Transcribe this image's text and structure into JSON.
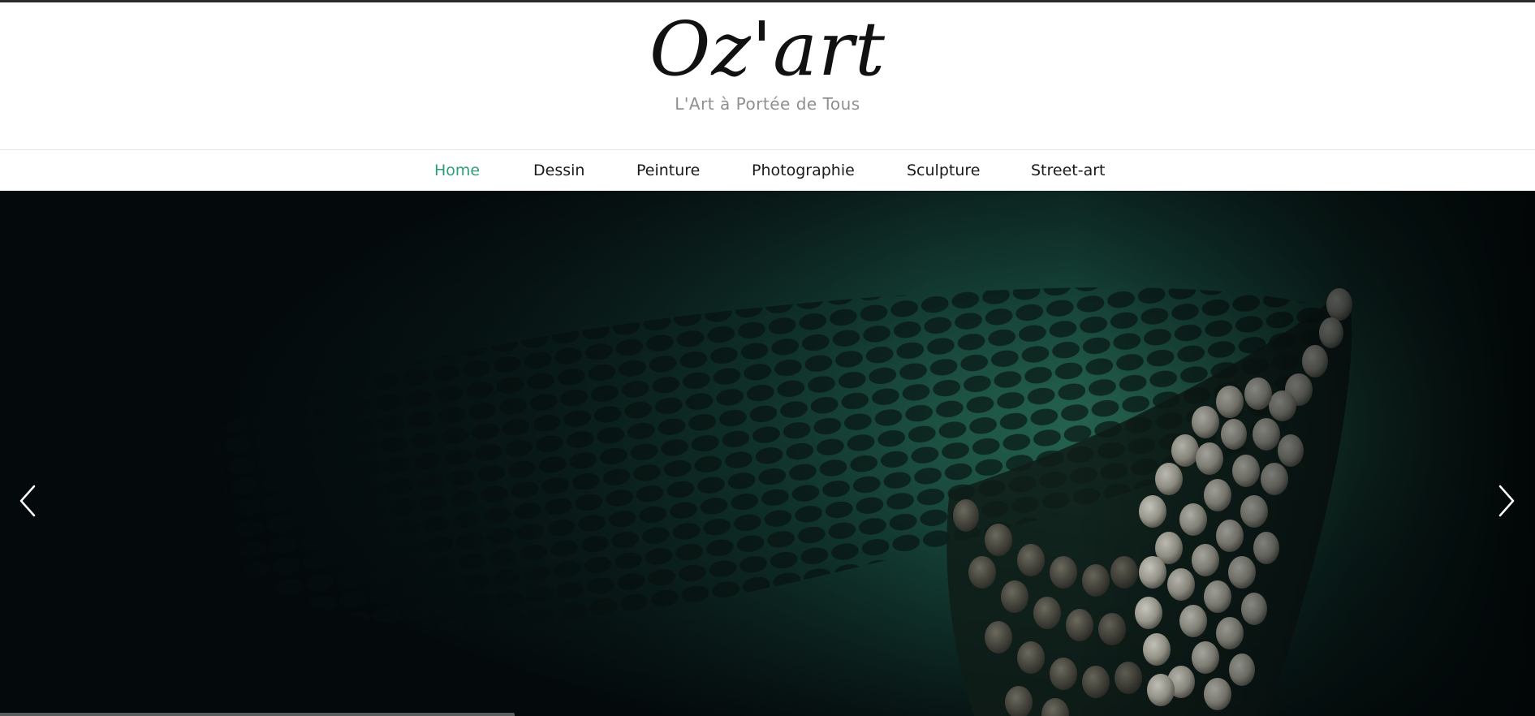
{
  "header": {
    "title": "Oz'art",
    "tagline": "L'Art à Portée de Tous"
  },
  "nav": {
    "items": [
      {
        "label": "Home",
        "active": true
      },
      {
        "label": "Dessin",
        "active": false
      },
      {
        "label": "Peinture",
        "active": false
      },
      {
        "label": "Photographie",
        "active": false
      },
      {
        "label": "Sculpture",
        "active": false
      },
      {
        "label": "Street-art",
        "active": false
      }
    ]
  },
  "slider": {
    "prev_icon": "chevron-left-icon",
    "next_icon": "chevron-right-icon",
    "image_subject": "sculpture-bowl-photo"
  },
  "colors": {
    "accent": "#2e9e7a",
    "text": "#1a1a1a",
    "tagline": "#8f8f8f",
    "hero_bg": "#050b0c",
    "hero_green": "#1f5a47"
  }
}
